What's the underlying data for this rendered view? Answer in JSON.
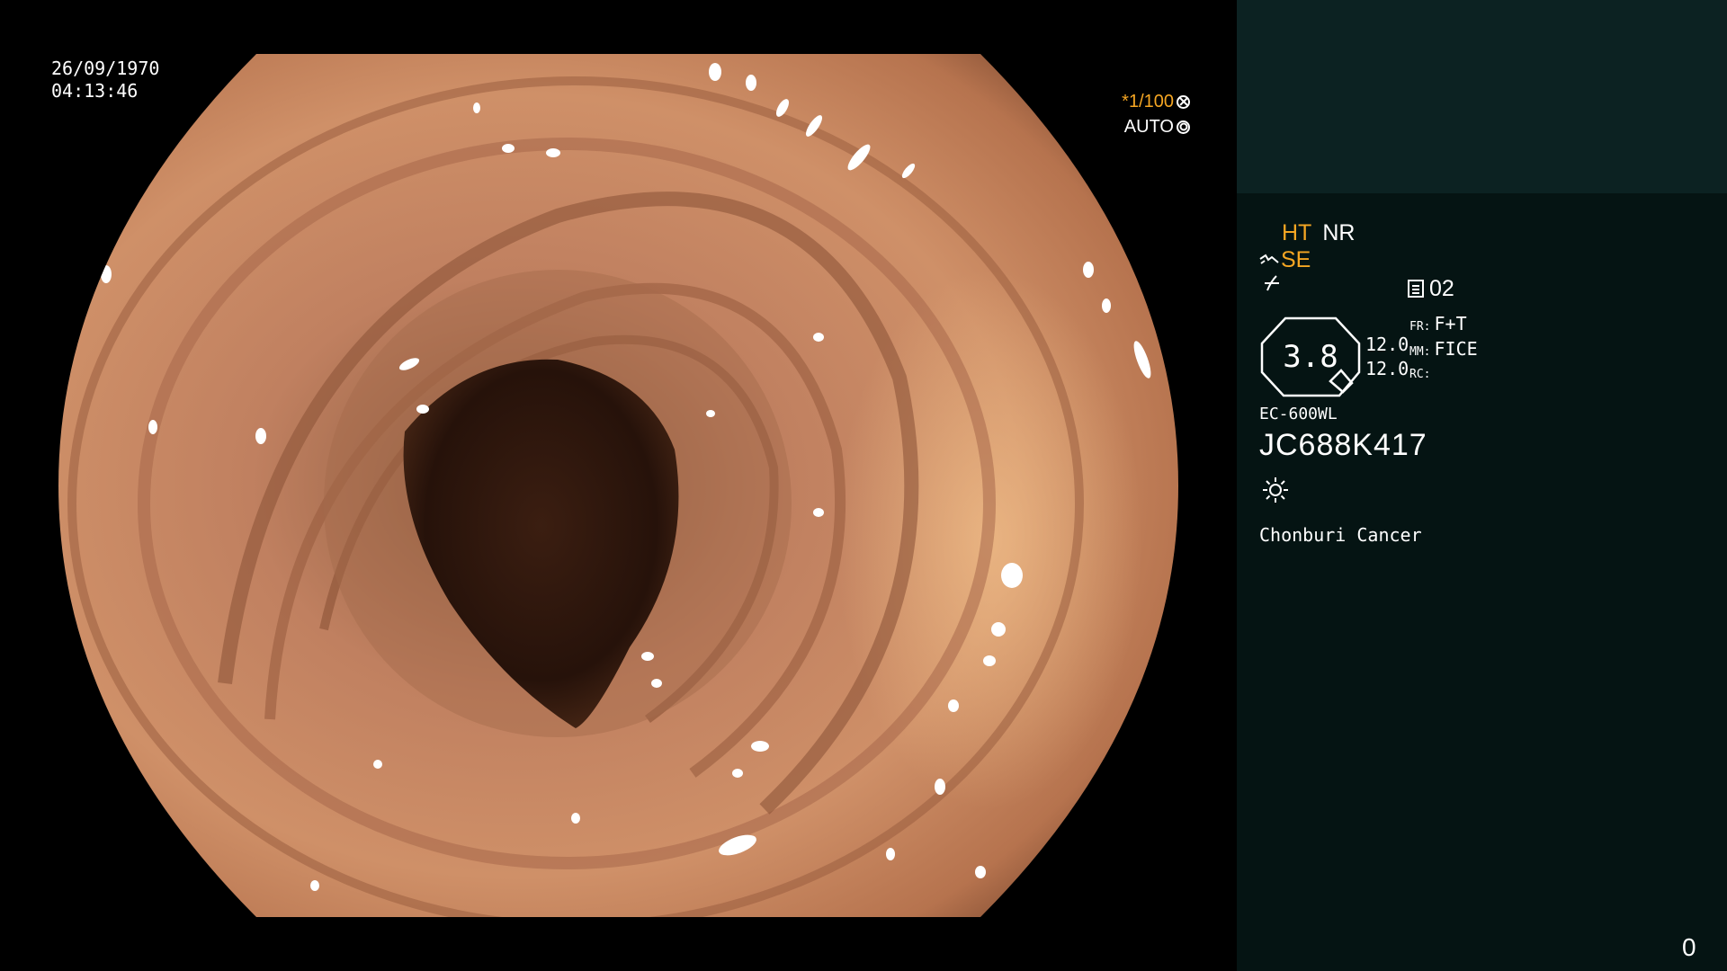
{
  "scope": {
    "date": "26/09/1970",
    "time": "04:13:46",
    "shutter_speed": "*1/100",
    "iris_mode": "AUTO",
    "colors": {
      "tissue": "#c98a63",
      "lumen": "#2a140c",
      "accent": "#f5a623"
    }
  },
  "panel": {
    "mode_ht": "HT",
    "mode_nr": "NR",
    "mode_se": "SE",
    "memo_number": "02",
    "zoom_value": "3.8",
    "ratio_top": "12.0",
    "ratio_bottom": "12.0",
    "fr_key": "FR:",
    "fr_value": "F+T",
    "mm_key": "MM:",
    "mm_value": "FICE",
    "rc_key": "RC:",
    "model": "EC-600WL",
    "serial": "JC688K417",
    "institution": "Chonburi Cancer",
    "counter": "0",
    "colors": {
      "panel_bg": "#051413",
      "panel_top": "#0c2222"
    }
  },
  "icons": [
    "shutter-cross-icon",
    "iris-ring-icon",
    "structure-wave-icon",
    "color-fork-icon",
    "memo-icon",
    "light-sun-icon"
  ]
}
